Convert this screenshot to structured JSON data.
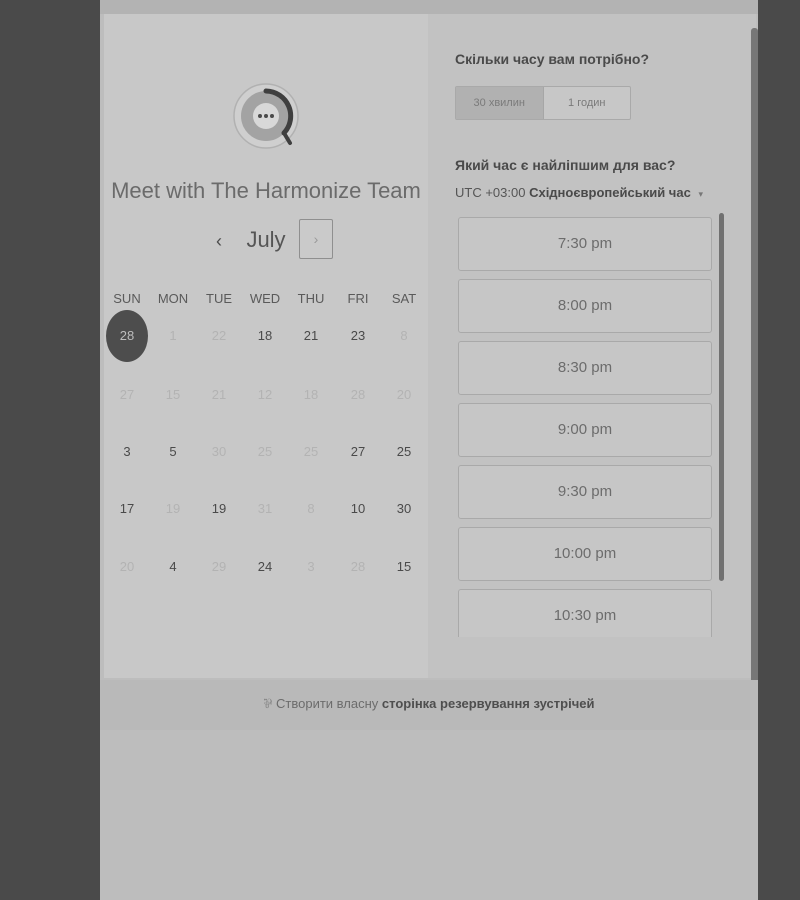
{
  "widget": {
    "title": "Meet with The Harmonize Team",
    "month": "July",
    "prev_icon": "‹",
    "next_icon": "›"
  },
  "weekdays": [
    "SUN",
    "MON",
    "TUE",
    "WED",
    "THU",
    "FRI",
    "SAT"
  ],
  "calendar_rows": [
    [
      {
        "label": "28",
        "state": "selected"
      },
      {
        "label": "1",
        "state": "disabled"
      },
      {
        "label": "22",
        "state": "disabled"
      },
      {
        "label": "18",
        "state": "available"
      },
      {
        "label": "21",
        "state": "available"
      },
      {
        "label": "23",
        "state": "available"
      },
      {
        "label": "8",
        "state": "disabled"
      }
    ],
    [
      {
        "label": "27",
        "state": "disabled"
      },
      {
        "label": "15",
        "state": "disabled"
      },
      {
        "label": "21",
        "state": "disabled"
      },
      {
        "label": "12",
        "state": "disabled"
      },
      {
        "label": "18",
        "state": "disabled"
      },
      {
        "label": "28",
        "state": "disabled"
      },
      {
        "label": "20",
        "state": "disabled"
      }
    ],
    [
      {
        "label": "3",
        "state": "available"
      },
      {
        "label": "5",
        "state": "available"
      },
      {
        "label": "30",
        "state": "disabled"
      },
      {
        "label": "25",
        "state": "disabled"
      },
      {
        "label": "25",
        "state": "disabled"
      },
      {
        "label": "27",
        "state": "available"
      },
      {
        "label": "25",
        "state": "available"
      }
    ],
    [
      {
        "label": "17",
        "state": "available"
      },
      {
        "label": "19",
        "state": "disabled"
      },
      {
        "label": "19",
        "state": "available"
      },
      {
        "label": "31",
        "state": "disabled"
      },
      {
        "label": "8",
        "state": "disabled"
      },
      {
        "label": "10",
        "state": "available"
      },
      {
        "label": "30",
        "state": "available"
      }
    ],
    [
      {
        "label": "20",
        "state": "disabled"
      },
      {
        "label": "4",
        "state": "available"
      },
      {
        "label": "29",
        "state": "disabled"
      },
      {
        "label": "24",
        "state": "available"
      },
      {
        "label": "3",
        "state": "disabled"
      },
      {
        "label": "28",
        "state": "disabled"
      },
      {
        "label": "15",
        "state": "available"
      }
    ]
  ],
  "booking": {
    "duration_title": "Скільки часу вам потрібно?",
    "duration_options": [
      "30 хвилин",
      "1 годин"
    ],
    "time_title": "Який час є найліпшим для вас?",
    "timezone_offset": "UTC +03:00",
    "timezone_name": "Східноєвропейський час",
    "timezone_caret": "▾",
    "slots": [
      "7:30 pm",
      "8:00 pm",
      "8:30 pm",
      "9:00 pm",
      "9:30 pm",
      "10:00 pm",
      "10:30 pm"
    ]
  },
  "footer": {
    "icon": "⅌",
    "prefix": "Створити власну",
    "link": "сторінка резервування зустрічей"
  }
}
